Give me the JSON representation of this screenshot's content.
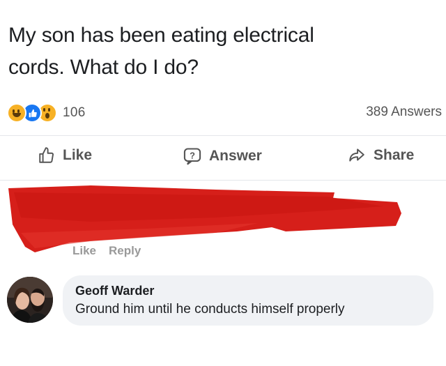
{
  "question": {
    "line1": "My son has been eating electrical",
    "line2": "cords. What do I do?"
  },
  "stats": {
    "reaction_icons": [
      "haha-icon",
      "like-icon",
      "wow-icon"
    ],
    "reaction_count": "106",
    "answers_count": "389 Answers"
  },
  "actions": {
    "like": "Like",
    "answer": "Answer",
    "share": "Share"
  },
  "hidden_comment": {
    "like": "Like",
    "reply": "Reply",
    "redaction_color": "#d61f1a"
  },
  "comment": {
    "author": "Geoff Warder",
    "text": "Ground him until he conducts himself properly"
  },
  "colors": {
    "accent_like": "#1877f2",
    "reaction_yellow": "#f7b125",
    "bubble_bg": "#f0f2f5",
    "muted_text": "#555555"
  }
}
